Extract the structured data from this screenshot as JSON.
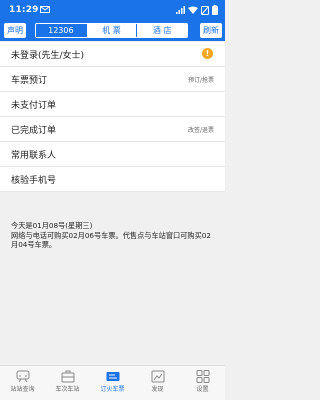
{
  "status_bar": {
    "time": "11:29"
  },
  "toolbar": {
    "left_button": "声明",
    "right_button": "刷新",
    "tabs": [
      {
        "label": "12306",
        "active": true
      },
      {
        "label": "机 票",
        "active": false
      },
      {
        "label": "酒 店",
        "active": false
      }
    ]
  },
  "menu": [
    {
      "label": "未登录(先生/女士)",
      "hint": "",
      "icon": "warning-icon"
    },
    {
      "label": "车票预订",
      "hint": "预订/抢票"
    },
    {
      "label": "未支付订单",
      "hint": ""
    },
    {
      "label": "已完成订单",
      "hint": "改签/退票"
    },
    {
      "label": "常用联系人",
      "hint": ""
    },
    {
      "label": "核验手机号",
      "hint": ""
    }
  ],
  "notice": {
    "line1": "今天是01月08号(星期三)",
    "line2": "网络与电话可购买02月06号车票。代售点与车站窗口可购买02月04号车票。"
  },
  "bottom_nav": [
    {
      "label": "站站查询",
      "icon": "station-query-icon",
      "active": false
    },
    {
      "label": "车次车站",
      "icon": "train-station-icon",
      "active": false
    },
    {
      "label": "订火车票",
      "icon": "ticket-icon",
      "active": true
    },
    {
      "label": "发现",
      "icon": "discover-icon",
      "active": false
    },
    {
      "label": "设置",
      "icon": "settings-grid-icon",
      "active": false
    }
  ],
  "colors": {
    "accent": "#1a73e8",
    "warning": "#f5a623"
  }
}
